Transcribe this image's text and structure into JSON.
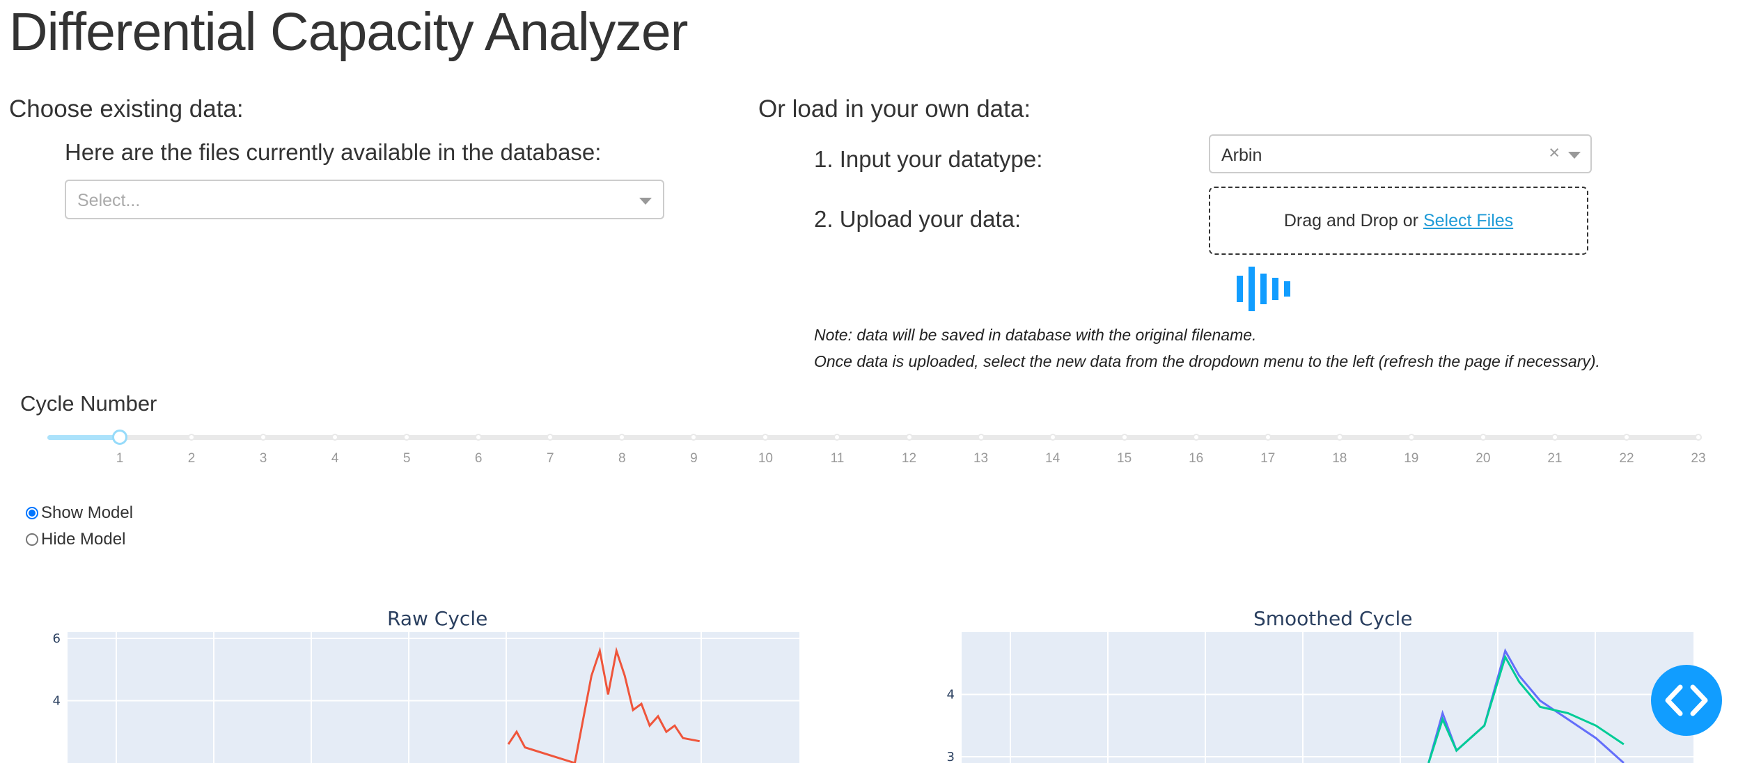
{
  "title": "Differential Capacity Analyzer",
  "existing": {
    "heading": "Choose existing data:",
    "files_label": "Here are the files currently available in the database:",
    "select_placeholder": "Select..."
  },
  "own": {
    "heading": "Or load in your own data:",
    "datatype_label": "1. Input your datatype:",
    "datatype_value": "Arbin",
    "clear_symbol": "×",
    "upload_label": "2. Upload your data:",
    "upload_prefix": "Drag and Drop or ",
    "upload_link": "Select Files",
    "note_line1": "Note: data will be saved in database with the original filename.",
    "note_line2": "Once data is uploaded, select the new data from the dropdown menu to the left (refresh the page if necessary)."
  },
  "cycle": {
    "label": "Cycle Number",
    "selected": 1,
    "ticks": [
      "1",
      "2",
      "3",
      "4",
      "5",
      "6",
      "7",
      "8",
      "9",
      "10",
      "11",
      "12",
      "13",
      "14",
      "15",
      "16",
      "17",
      "18",
      "19",
      "20",
      "21",
      "22",
      "23"
    ]
  },
  "model_toggle": {
    "options": [
      "Show Model",
      "Hide Model"
    ],
    "selected": "Show Model"
  },
  "colors": {
    "accent": "#119dff",
    "raw_series": "#ef553b",
    "smoothed_series": "#636efa",
    "model_series": "#00cc96",
    "plot_bg": "#e5ecf6"
  },
  "chart_data": [
    {
      "type": "line",
      "title": "Raw Cycle",
      "yticks": [
        "4",
        "6"
      ],
      "series": [
        {
          "values": [
            [
              3.2,
              2.6
            ],
            [
              3.21,
              3.0
            ],
            [
              3.22,
              2.5
            ],
            [
              3.28,
              2.0
            ],
            [
              3.3,
              4.8
            ],
            [
              3.31,
              5.6
            ],
            [
              3.32,
              4.2
            ],
            [
              3.33,
              5.6
            ],
            [
              3.34,
              4.8
            ],
            [
              3.35,
              3.7
            ],
            [
              3.36,
              3.9
            ],
            [
              3.37,
              3.2
            ],
            [
              3.38,
              3.5
            ],
            [
              3.39,
              3.0
            ],
            [
              3.4,
              3.2
            ],
            [
              3.41,
              2.8
            ],
            [
              3.43,
              2.7
            ]
          ]
        }
      ]
    },
    {
      "type": "line",
      "title": "Smoothed Cycle",
      "yticks": [
        "3",
        "4"
      ],
      "series": [
        {
          "values": [
            [
              3.22,
              2.9
            ],
            [
              3.24,
              3.7
            ],
            [
              3.26,
              3.1
            ],
            [
              3.3,
              3.5
            ],
            [
              3.33,
              4.7
            ],
            [
              3.35,
              4.3
            ],
            [
              3.38,
              3.9
            ],
            [
              3.42,
              3.6
            ],
            [
              3.46,
              3.3
            ],
            [
              3.5,
              2.9
            ]
          ]
        },
        {
          "values": [
            [
              3.22,
              2.9
            ],
            [
              3.24,
              3.6
            ],
            [
              3.26,
              3.1
            ],
            [
              3.3,
              3.5
            ],
            [
              3.33,
              4.6
            ],
            [
              3.35,
              4.2
            ],
            [
              3.38,
              3.8
            ],
            [
              3.42,
              3.7
            ],
            [
              3.46,
              3.5
            ],
            [
              3.5,
              3.2
            ]
          ]
        }
      ]
    }
  ]
}
